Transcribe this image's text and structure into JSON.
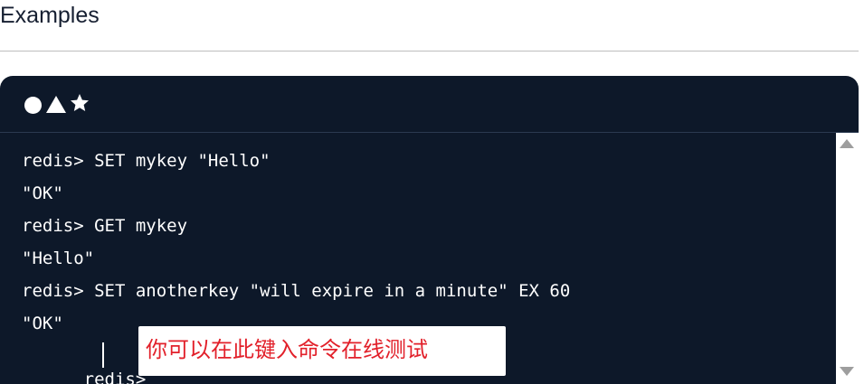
{
  "section": {
    "heading": "Examples"
  },
  "console": {
    "header_icons": [
      "circle-icon",
      "triangle-icon",
      "star-icon"
    ],
    "lines": [
      "redis> SET mykey \"Hello\"",
      "\"OK\"",
      "redis> GET mykey",
      "\"Hello\"",
      "redis> SET anotherkey \"will expire in a minute\" EX 60",
      "\"OK\""
    ],
    "prompt": "redis> ",
    "input_value": ""
  },
  "tooltip": {
    "text": "你可以在此键入命令在线测试"
  },
  "colors": {
    "console_background": "#0d1829",
    "tooltip_text": "#e2202a"
  }
}
